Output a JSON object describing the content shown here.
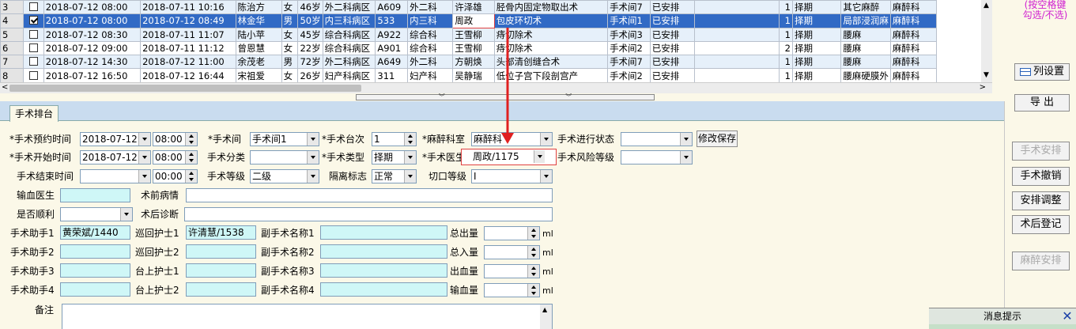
{
  "grid": {
    "rows": [
      {
        "rn": "3",
        "chk": false,
        "appt": "2018-07-12 08:00",
        "start": "2018-07-11 10:16",
        "name": "陈治方",
        "sex": "女",
        "age": "46岁",
        "ward": "外二科病区",
        "bed": "A609",
        "dept": "外二科",
        "doc": "许泽雄",
        "op": "胫骨内固定物取出术",
        "room": "手术间7",
        "status": "已安排",
        "extra": "",
        "seq": "1",
        "type": "择期",
        "anes": "其它麻醉",
        "anesdept": "麻醉科"
      },
      {
        "rn": "4",
        "chk": true,
        "appt": "2018-07-12 08:00",
        "start": "2018-07-12 08:49",
        "name": "林金华",
        "sex": "男",
        "age": "50岁",
        "ward": "内三科病区",
        "bed": "533",
        "dept": "内三科",
        "doc": "周政",
        "op": "包皮环切术",
        "room": "手术间1",
        "status": "已安排",
        "extra": "",
        "seq": "1",
        "type": "择期",
        "anes": "局部浸润麻",
        "anesdept": "麻醉科"
      },
      {
        "rn": "5",
        "chk": false,
        "appt": "2018-07-12 08:30",
        "start": "2018-07-11 11:07",
        "name": "陆小苹",
        "sex": "女",
        "age": "45岁",
        "ward": "综合科病区",
        "bed": "A922",
        "dept": "综合科",
        "doc": "王雪柳",
        "op": "痔切除术",
        "room": "手术间3",
        "status": "已安排",
        "extra": "",
        "seq": "1",
        "type": "择期",
        "anes": "腰麻",
        "anesdept": "麻醉科"
      },
      {
        "rn": "6",
        "chk": false,
        "appt": "2018-07-12 09:00",
        "start": "2018-07-11 11:12",
        "name": "曾恩慧",
        "sex": "女",
        "age": "22岁",
        "ward": "综合科病区",
        "bed": "A901",
        "dept": "综合科",
        "doc": "王雪柳",
        "op": "痔切除术",
        "room": "手术间2",
        "status": "已安排",
        "extra": "",
        "seq": "2",
        "type": "择期",
        "anes": "腰麻",
        "anesdept": "麻醉科"
      },
      {
        "rn": "7",
        "chk": false,
        "appt": "2018-07-12 14:30",
        "start": "2018-07-12 11:00",
        "name": "余茂老",
        "sex": "男",
        "age": "72岁",
        "ward": "外二科病区",
        "bed": "A649",
        "dept": "外二科",
        "doc": "方朝焕",
        "op": "头部清创缝合术",
        "room": "手术间7",
        "status": "已安排",
        "extra": "",
        "seq": "1",
        "type": "择期",
        "anes": "腰麻",
        "anesdept": "麻醉科"
      },
      {
        "rn": "8",
        "chk": false,
        "appt": "2018-07-12 16:50",
        "start": "2018-07-12 16:44",
        "name": "宋祖爱",
        "sex": "女",
        "age": "26岁",
        "ward": "妇产科病区",
        "bed": "311",
        "dept": "妇产科",
        "doc": "吴静瑞",
        "op": "低位子宫下段剖宫产",
        "room": "手术间2",
        "status": "已安排",
        "extra": "",
        "seq": "1",
        "type": "择期",
        "anes": "腰麻硬膜外",
        "anesdept": "麻醉科"
      }
    ],
    "selected_row": 1
  },
  "side": {
    "hint": "(按空格键\n勾选/不选)",
    "column_settings": "列设置",
    "export": "导  出",
    "btn_arrange": "手术安排",
    "btn_cancel": "手术撤销",
    "btn_adjust": "安排调整",
    "btn_postop": "术后登记",
    "btn_anes": "麻醉安排"
  },
  "tab": {
    "label": "手术排台"
  },
  "form": {
    "l_appt_time": "*手术预约时间",
    "v_appt_date": "2018-07-12",
    "v_appt_hm": "08:00",
    "l_room": "*手术间",
    "v_room": "手术间1",
    "l_seq": "*手术台次",
    "v_seq": "1",
    "l_anes_dept": "*麻醉科室",
    "v_anes_dept": "麻醉科",
    "l_progress": "手术进行状态",
    "v_progress": "",
    "save_btn": "修改保存",
    "l_start_time": "*手术开始时间",
    "v_start_date": "2018-07-12",
    "v_start_hm": "08:00",
    "l_category": "手术分类",
    "v_category": "",
    "l_op_type": "*手术类型",
    "v_op_type": "择期",
    "l_doctor": "*手术医生",
    "v_doctor": "周政/1175",
    "l_risk": "手术风险等级",
    "v_risk": "",
    "l_end_time": "手术结束时间",
    "v_end_date": "",
    "v_end_hm": "00:00",
    "l_grade": "手术等级",
    "v_grade": "二级",
    "l_isolation": "隔离标志",
    "v_isolation": "正常",
    "l_incision": "切口等级",
    "v_incision": "I",
    "l_transfusion_doc": "输血医生",
    "v_transfusion_doc": "",
    "l_preop_dx": "术前病情",
    "v_preop_dx": "",
    "l_smooth": "是否顺利",
    "v_smooth": "",
    "l_postop_dx": "术后诊断",
    "v_postop_dx": "",
    "l_assist1": "手术助手1",
    "v_assist1": "黄荣斌/1440",
    "l_circ1": "巡回护士1",
    "v_circ1": "许清慧/1538",
    "l_sub1": "副手术名称1",
    "v_sub1": "",
    "l_total_out": "总出量",
    "u_total_out": "ml",
    "l_assist2": "手术助手2",
    "v_assist2": "",
    "l_circ2": "巡回护士2",
    "v_circ2": "",
    "l_sub2": "副手术名称2",
    "v_sub2": "",
    "l_total_in": "总入量",
    "u_total_in": "ml",
    "l_assist3": "手术助手3",
    "v_assist3": "",
    "l_scrub1": "台上护士1",
    "v_scrub1": "",
    "l_sub3": "副手术名称3",
    "v_sub3": "",
    "l_blood_loss": "出血量",
    "u_blood_loss": "ml",
    "l_assist4": "手术助手4",
    "v_assist4": "",
    "l_scrub2": "台上护士2",
    "v_scrub2": "",
    "l_sub4": "副手术名称4",
    "v_sub4": "",
    "l_transfusion": "输血量",
    "u_transfusion": "ml",
    "l_remark": "备注",
    "v_remark": ""
  },
  "message": {
    "title": "消息提示"
  },
  "colors": {
    "selected": "#316ac5",
    "highlight": "#e04040",
    "field_cyan": "#cff7f7",
    "tab_strip": "#c9dcef",
    "background": "#fbf8e8"
  }
}
